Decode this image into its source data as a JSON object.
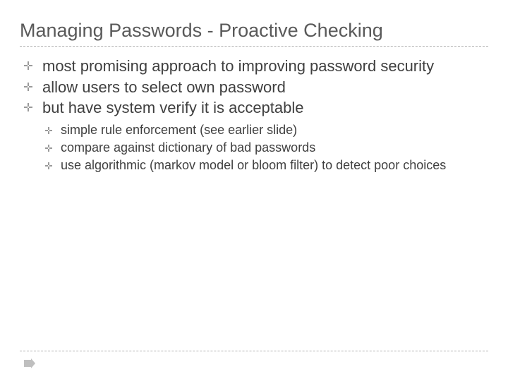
{
  "title": "Managing Passwords - Proactive Checking",
  "bullets": [
    {
      "text": "most promising approach to improving password security"
    },
    {
      "text": "allow users to select own password"
    },
    {
      "text": "but have system verify it is acceptable"
    }
  ],
  "subbullets": [
    {
      "text": "simple rule enforcement (see earlier slide)"
    },
    {
      "text": "compare against dictionary of bad passwords"
    },
    {
      "text": "use algorithmic (markov model or bloom filter) to detect poor choices"
    }
  ]
}
